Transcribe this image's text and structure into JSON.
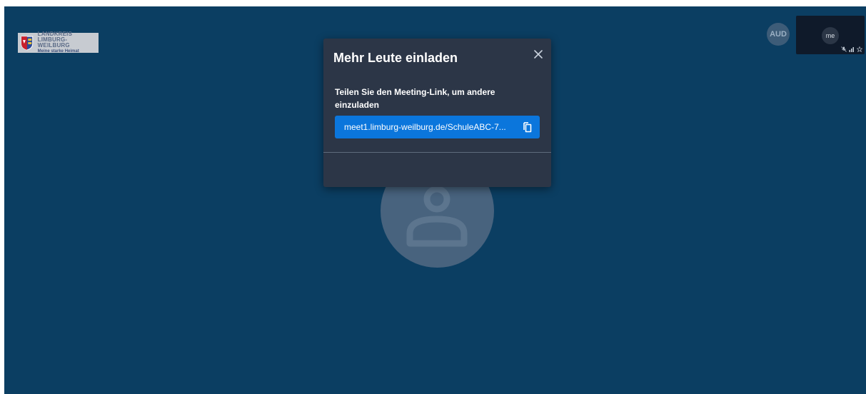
{
  "logo": {
    "line1": "LANDKREIS",
    "line2": "LIMBURG-WEILBURG",
    "tagline": "Meine starke Heimat"
  },
  "participants": {
    "remote_badge": "AUD",
    "self_label": "me"
  },
  "invite_dialog": {
    "title": "Mehr Leute einladen",
    "hint": "Teilen Sie den Meeting-Link, um andere einzuladen",
    "meeting_link": "meet1.limburg-weilburg.de/SchuleABC-7..."
  },
  "colors": {
    "stage_background": "#0b3e62",
    "dialog_background": "#2c3647",
    "link_button": "#0b76dc",
    "avatar_circle": "#48637e"
  },
  "icons": {
    "close": "close-icon",
    "copy": "copy-icon",
    "avatar": "user-silhouette-icon",
    "self_indicators": [
      "mic-muted-icon",
      "signal-icon",
      "star-icon"
    ]
  }
}
